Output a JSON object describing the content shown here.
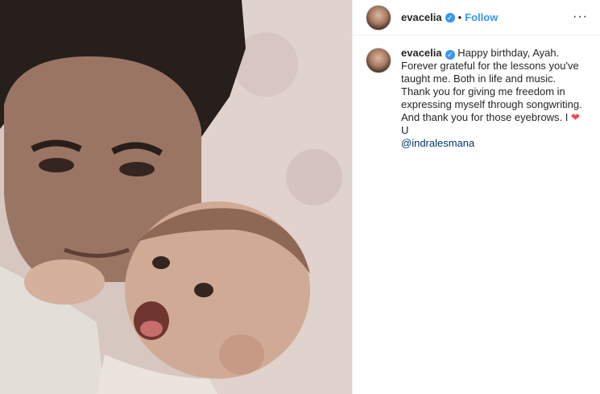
{
  "post": {
    "username": "evacelia",
    "dot": "•",
    "follow_label": "Follow",
    "more_label": "···"
  },
  "caption": {
    "username": "evacelia",
    "text_part1": "Happy birthday, Ayah. Forever grateful for the lessons you've taught me. Both in life and music. Thank you for giving me freedom in expressing myself through songwriting. And thank you for those eyebrows. I",
    "heart": "❤",
    "text_part2": "U",
    "mention": "@indralesmana"
  },
  "icons": {
    "verified": "verified-badge-icon",
    "more": "more-options-icon"
  },
  "colors": {
    "link": "#3897f0",
    "heart": "#ed4956"
  }
}
